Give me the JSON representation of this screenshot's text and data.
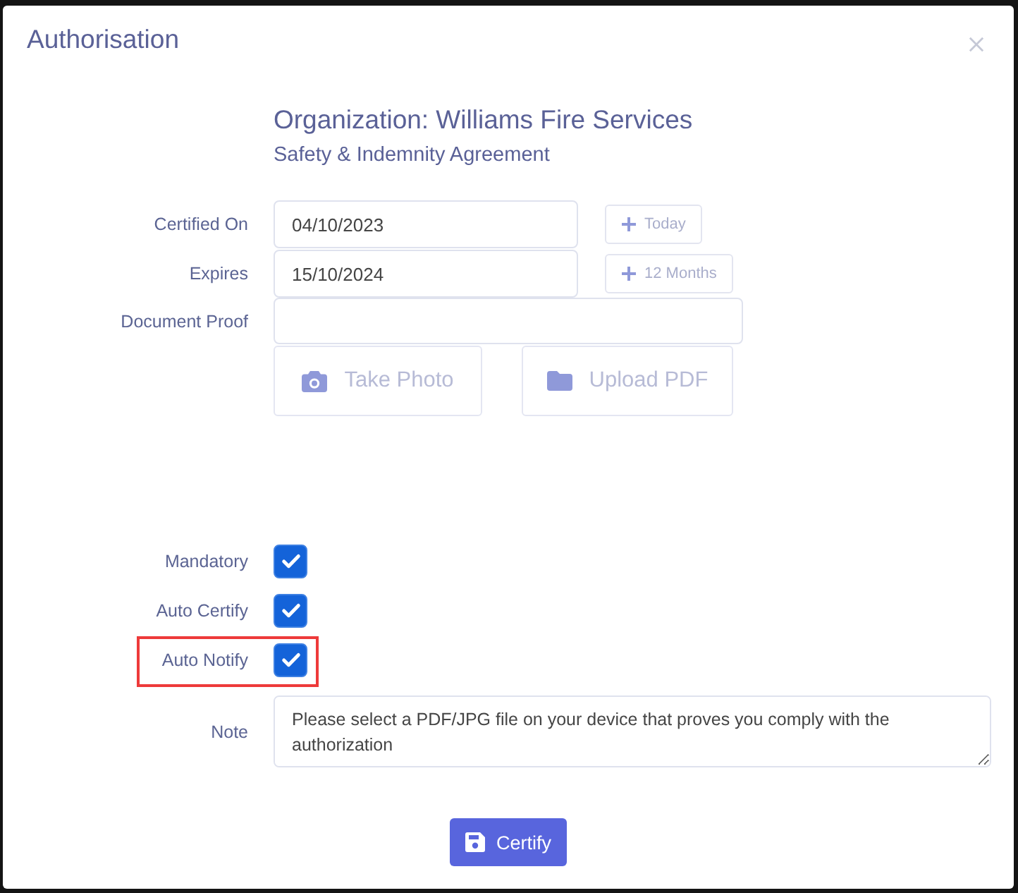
{
  "dialog": {
    "title": "Authorisation"
  },
  "heading": {
    "organization": "Organization: Williams Fire Services",
    "agreement": "Safety & Indemnity Agreement"
  },
  "fields": [
    {
      "kind": "date",
      "label": "Certified On",
      "value": "04/10/2023",
      "action": "Today"
    },
    {
      "kind": "date",
      "label": "Expires",
      "value": "15/10/2024",
      "action": "12 Months"
    },
    {
      "kind": "file",
      "label": "Document Proof",
      "buttons": [
        {
          "kind": "photo",
          "label": "Take Photo"
        },
        {
          "kind": "pdf",
          "label": "Upload PDF"
        }
      ]
    }
  ],
  "checkboxes": [
    {
      "label": "Mandatory",
      "checked": true,
      "highlighted": false
    },
    {
      "label": "Auto Certify",
      "checked": true,
      "highlighted": false
    },
    {
      "label": "Auto Notify",
      "checked": true,
      "highlighted": true
    }
  ],
  "note": {
    "label": "Note",
    "value": "Please select a PDF/JPG file on your device that proves you comply with the authorization"
  },
  "submit": {
    "label": "Certify"
  }
}
